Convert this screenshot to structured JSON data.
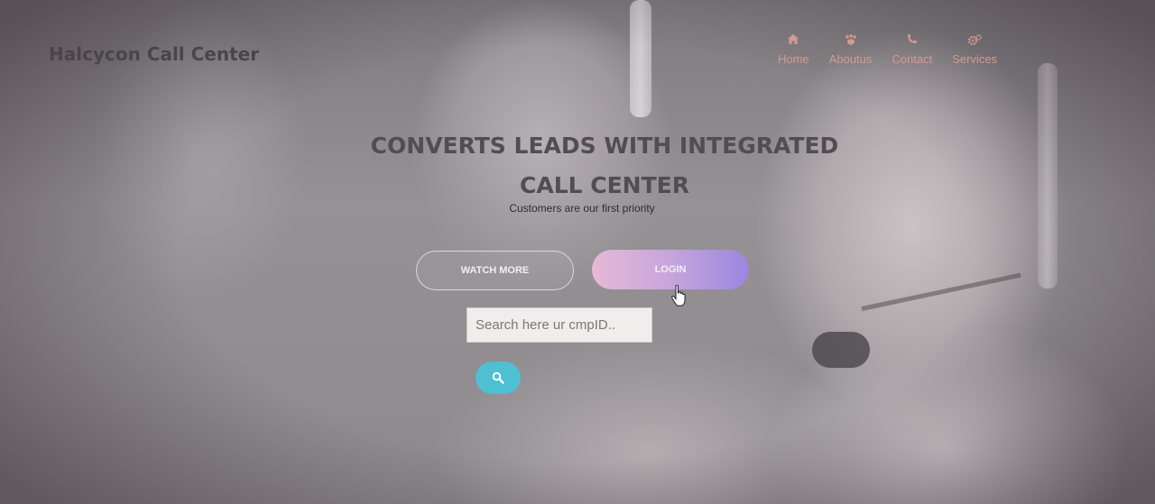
{
  "brand": {
    "name": "Halcycon Call Center"
  },
  "nav": {
    "items": [
      {
        "label": "Home",
        "icon": "home-icon"
      },
      {
        "label": "Aboutus",
        "icon": "paw-icon"
      },
      {
        "label": "Contact",
        "icon": "phone-icon"
      },
      {
        "label": "Services",
        "icon": "cogs-icon"
      }
    ],
    "color": "#d49a8e"
  },
  "hero": {
    "headline_line1": "CONVERTS LEADS WITH INTEGRATED",
    "headline_line2": "CALL CENTER",
    "subline": "Customers are our first priority",
    "watch_button": "WATCH MORE",
    "login_button": "LOGIN"
  },
  "search": {
    "placeholder": "Search here ur cmpID..",
    "value": "",
    "button_icon": "search-icon",
    "button_color": "#4fbfd2"
  },
  "colors": {
    "login_gradient_start": "#e6b9d6",
    "login_gradient_end": "#9a86e0"
  }
}
